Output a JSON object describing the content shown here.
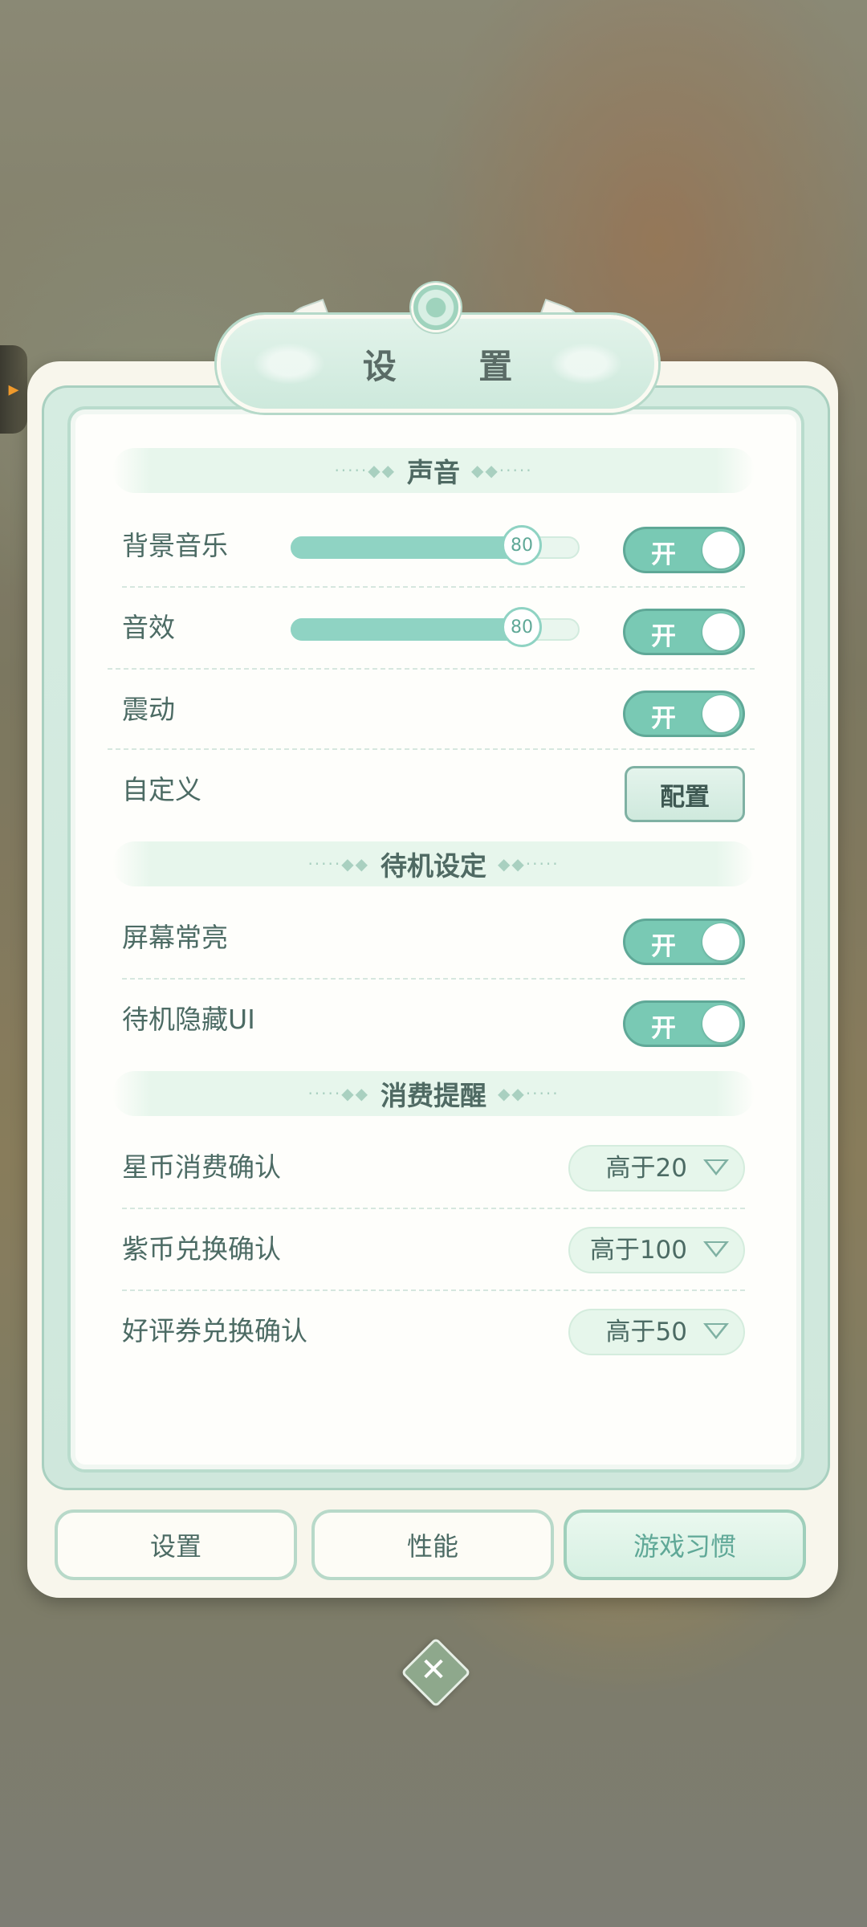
{
  "title": "设 置",
  "sections": {
    "sound": "声音",
    "standby": "待机设定",
    "spending": "消费提醒"
  },
  "sound_rows": {
    "bgm": {
      "label": "背景音乐",
      "value": 80,
      "toggle": "开"
    },
    "sfx": {
      "label": "音效",
      "value": 80,
      "toggle": "开"
    },
    "vibration": {
      "label": "震动",
      "toggle": "开"
    },
    "custom": {
      "label": "自定义",
      "button": "配置"
    }
  },
  "standby_rows": {
    "screen_on": {
      "label": "屏幕常亮",
      "toggle": "开"
    },
    "hide_ui": {
      "label": "待机隐藏UI",
      "toggle": "开"
    }
  },
  "spending_rows": {
    "star_coin": {
      "label": "星币消费确认",
      "value": "高于20"
    },
    "purple_coin": {
      "label": "紫币兑换确认",
      "value": "高于100"
    },
    "review_ticket": {
      "label": "好评券兑换确认",
      "value": "高于50"
    }
  },
  "tabs": [
    "设置",
    "性能",
    "游戏习惯"
  ],
  "active_tab": 2,
  "icons": {
    "side_tab": "chevron-right-icon",
    "close": "close-icon",
    "dropdown": "chevron-down-icon"
  },
  "colors": {
    "accent": "#79c9b4",
    "text": "#4c6b64",
    "panel": "#fefefb"
  }
}
